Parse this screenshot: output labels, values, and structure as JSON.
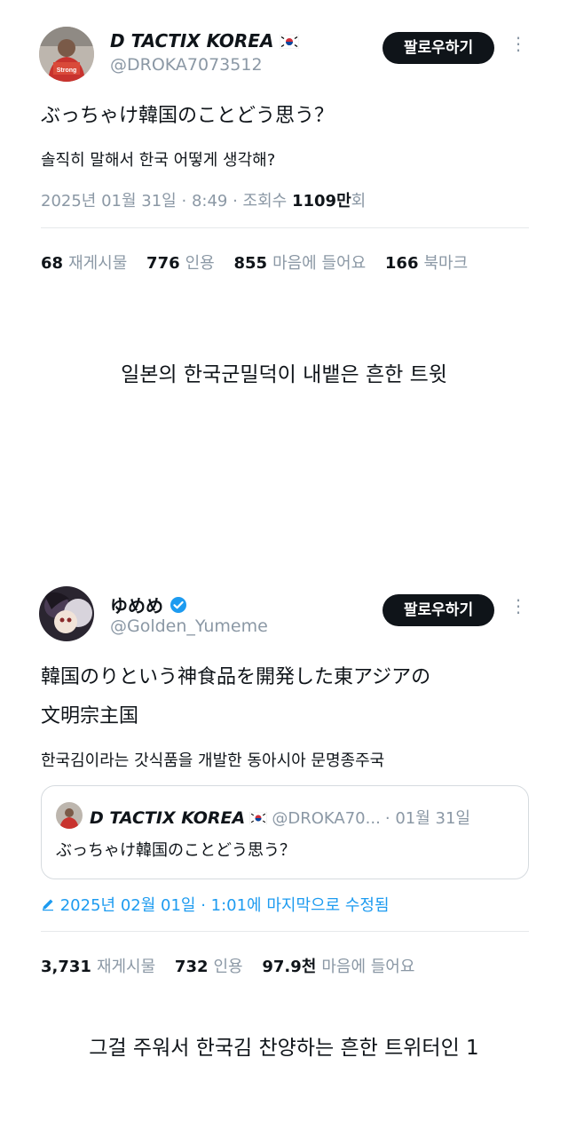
{
  "tweet1": {
    "display_name": "D TACTIX KOREA",
    "flag": "korea-flag",
    "handle": "@DROKA7073512",
    "follow_label": "팔로우하기",
    "text_jp": "ぶっちゃけ韓国のことどう思う？",
    "text_kr": "솔직히 말해서 한국 어떻게 생각해?",
    "meta": {
      "date": "2025년 01월 31일",
      "time": "8:49",
      "views_label": "조회수",
      "views_count": "1109만",
      "views_suffix": "회"
    },
    "stats": [
      {
        "num": "68",
        "label": "재게시물"
      },
      {
        "num": "776",
        "label": "인용"
      },
      {
        "num": "855",
        "label": "마음에 들어요"
      },
      {
        "num": "166",
        "label": "북마크"
      }
    ]
  },
  "caption1": "일본의 한국군밀덕이 내뱉은 흔한 트윗",
  "tweet2": {
    "display_name": "ゆめめ",
    "verified_icon": "verified-badge-icon",
    "handle": "@Golden_Yumeme",
    "follow_label": "팔로우하기",
    "text_jp_line1": "韓国のりという神食品を開発した東アジアの",
    "text_jp_line2": "文明宗主国",
    "text_kr": "한국김이라는 갓식품을 개발한 동아시아 문명종주국",
    "quote": {
      "display_name": "D TACTIX KOREA",
      "handle": "@DROKA70...",
      "date": "· 01월 31일",
      "text": "ぶっちゃけ韓国のことどう思う？"
    },
    "edited": "2025년 02월 01일 · 1:01에 마지막으로 수정됨",
    "stats": [
      {
        "num": "3,731",
        "label": "재게시물"
      },
      {
        "num": "732",
        "label": "인용"
      },
      {
        "num": "97.9천",
        "label": "마음에 들어요"
      }
    ]
  },
  "caption2": "그걸 주워서 한국김 찬양하는 흔한 트위터인 1",
  "colors": {
    "text": "#0f1419",
    "muted": "#8b98a5",
    "accent": "#1d9bf0",
    "button": "#0f1419"
  }
}
